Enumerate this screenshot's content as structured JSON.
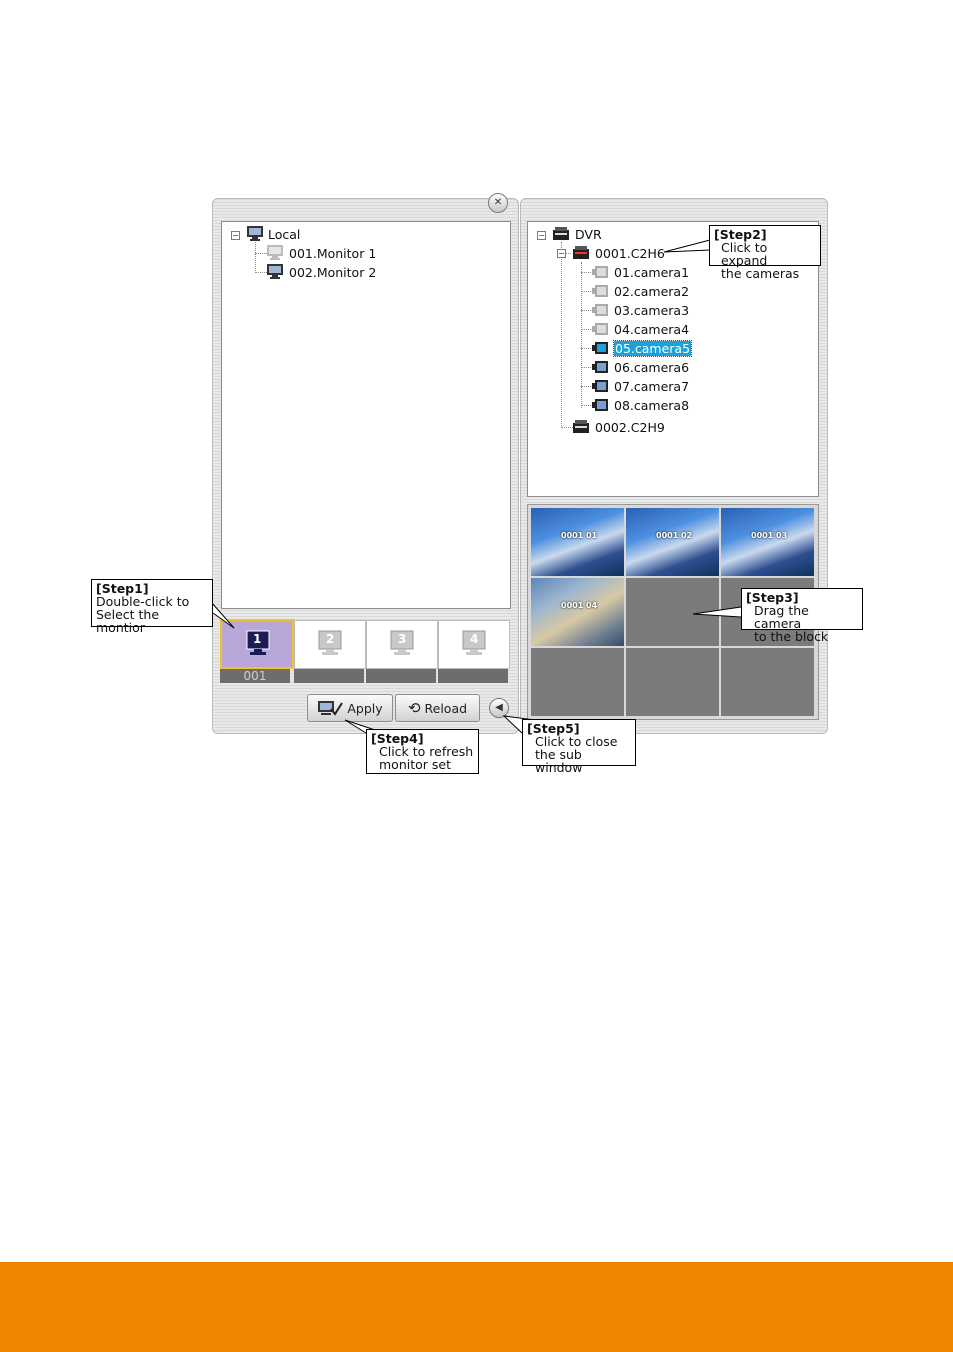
{
  "left_panel": {
    "close_icon": "close-icon",
    "tree": {
      "root": "Local",
      "monitors": [
        "001.Monitor 1",
        "002.Monitor 2"
      ]
    },
    "monitor_slots": [
      "1",
      "2",
      "3",
      "4"
    ],
    "selected_slot_label": "001",
    "apply_label": "Apply",
    "reload_label": "Reload",
    "collapse_icon": "chevron-left-icon"
  },
  "right_panel": {
    "tree": {
      "root": "DVR",
      "device1": "0001.C2H6",
      "cameras": [
        "01.camera1",
        "02.camera2",
        "03.camera3",
        "04.camera4",
        "05.camera5",
        "06.camera6",
        "07.camera7",
        "08.camera8"
      ],
      "selected_camera_index": 4,
      "device2": "0002.C2H9"
    },
    "grid_labels": [
      "0001 01",
      "0001 02",
      "0001 03",
      "0001 04"
    ]
  },
  "callouts": {
    "step1": {
      "title": "[Step1]",
      "line1": "Double-click to",
      "line2": "Select the montior"
    },
    "step2": {
      "title": "[Step2]",
      "line1": "Click to expand",
      "line2": "the cameras"
    },
    "step3": {
      "title": "[Step3]",
      "line1": "Drag the camera",
      "line2": "to the block"
    },
    "step4": {
      "title": "[Step4]",
      "line1": "Click to refresh",
      "line2": "monitor set"
    },
    "step5": {
      "title": "[Step5]",
      "line1": "Click to close",
      "line2": "the sub window"
    }
  },
  "colors": {
    "footer": "#ef8400",
    "selection": "#1ba3d9",
    "active_slot": "#b8a7d8",
    "active_border": "#f3c227"
  }
}
